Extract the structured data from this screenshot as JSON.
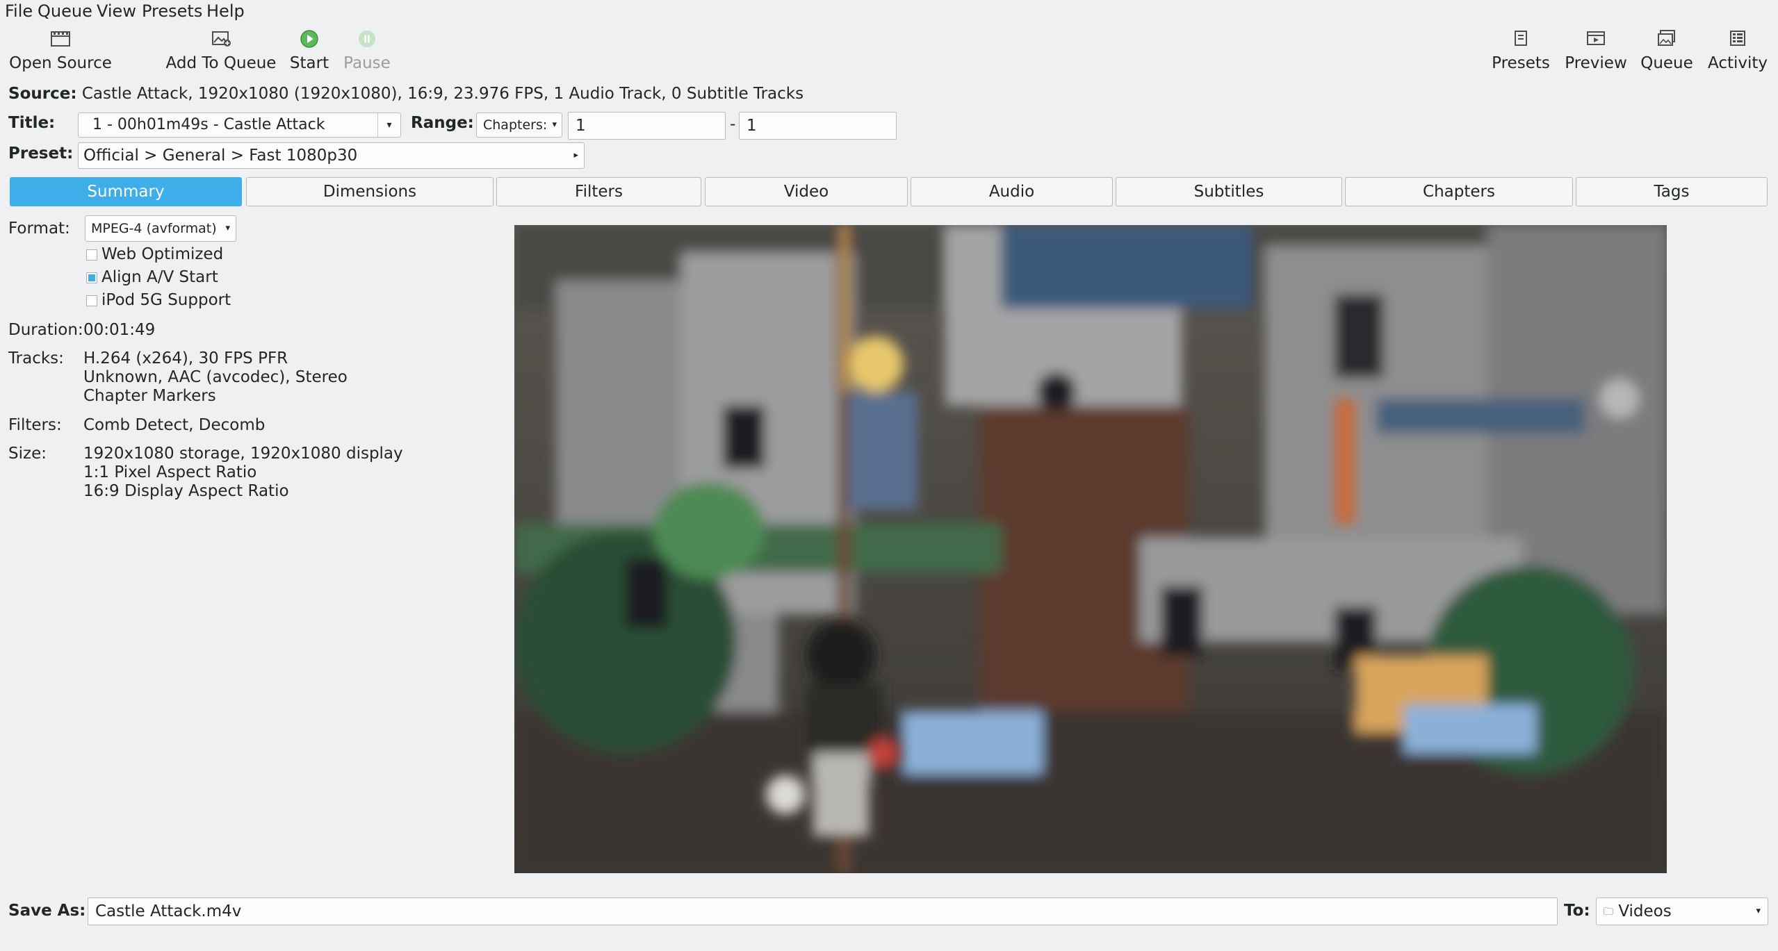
{
  "menu": [
    "File",
    "Queue",
    "View",
    "Presets",
    "Help"
  ],
  "toolbar": {
    "open_source": "Open Source",
    "add_to_queue": "Add To Queue",
    "start": "Start",
    "pause": "Pause",
    "presets": "Presets",
    "preview": "Preview",
    "queue": "Queue",
    "activity": "Activity"
  },
  "source": {
    "label": "Source:",
    "value": "Castle Attack, 1920x1080 (1920x1080), 16:9, 23.976 FPS, 1 Audio Track, 0 Subtitle Tracks"
  },
  "title": {
    "label": "Title:",
    "value": "1 - 00h01m49s - Castle Attack"
  },
  "range": {
    "label": "Range:",
    "mode": "Chapters:",
    "from": "1",
    "dash": "-",
    "to": "1"
  },
  "preset": {
    "label": "Preset:",
    "value": "Official > General > Fast 1080p30"
  },
  "tabs": [
    "Summary",
    "Dimensions",
    "Filters",
    "Video",
    "Audio",
    "Subtitles",
    "Chapters",
    "Tags"
  ],
  "summary": {
    "format_label": "Format:",
    "format_value": "MPEG-4 (avformat)",
    "web_optimized": "Web Optimized",
    "align_av": "Align A/V Start",
    "ipod": "iPod 5G Support",
    "duration_label": "Duration:",
    "duration_value": "00:01:49",
    "tracks_label": "Tracks:",
    "tracks": [
      "H.264 (x264), 30 FPS PFR",
      "Unknown, AAC (avcodec), Stereo",
      "Chapter Markers"
    ],
    "filters_label": "Filters:",
    "filters_value": "Comb Detect, Decomb",
    "size_label": "Size:",
    "size": [
      "1920x1080 storage, 1920x1080 display",
      "1:1 Pixel Aspect Ratio",
      "16:9 Display Aspect Ratio"
    ]
  },
  "save": {
    "label": "Save As:",
    "value": "Castle Attack.m4v",
    "to_label": "To:",
    "to_value": "Videos"
  },
  "colors": {
    "accent": "#3daee9",
    "background": "#eff0f1",
    "start_green": "#5cb85c"
  }
}
